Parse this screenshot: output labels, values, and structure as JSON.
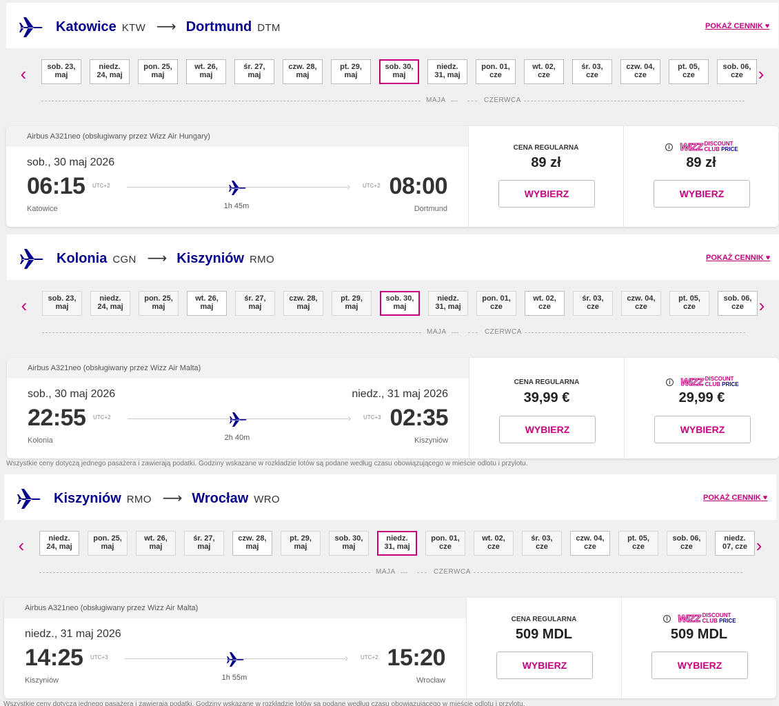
{
  "colors": {
    "brand_blue": "#06038d",
    "brand_pink": "#c6007e"
  },
  "icons": {
    "route": "airplane-icon",
    "prev": "chevron-left-icon",
    "next": "chevron-right-icon",
    "info": "info-icon"
  },
  "common": {
    "pokaz_cennik": "POKAŻ CENNIK",
    "cena_regularna": "CENA REGULARNA",
    "wybierz": "WYBIERZ",
    "discount_club": {
      "brand": "WIZZ",
      "line1": "DISCOUNT",
      "line2": "CLUB",
      "line3": "PRICE"
    },
    "month_left": "MAJA",
    "month_right": "CZERWCA",
    "disclaimer": "Wszystkie ceny dotyczą jednego pasażera i zawierają podatki. Godziny wskazane w rozkładzie lotów są podane według czasu obowiązującego w mieście odlotu i przylotu."
  },
  "flights": [
    {
      "from_city": "Katowice",
      "from_code": "KTW",
      "to_city": "Dortmund",
      "to_code": "DTM",
      "dates": [
        {
          "l1": "sob. 23,",
          "l2": "maj",
          "state": "normal"
        },
        {
          "l1": "niedz.",
          "l2": "24, maj",
          "state": "normal"
        },
        {
          "l1": "pon. 25,",
          "l2": "maj",
          "state": "normal"
        },
        {
          "l1": "wt. 26,",
          "l2": "maj",
          "state": "normal"
        },
        {
          "l1": "śr. 27,",
          "l2": "maj",
          "state": "normal"
        },
        {
          "l1": "czw. 28,",
          "l2": "maj",
          "state": "normal"
        },
        {
          "l1": "pt. 29,",
          "l2": "maj",
          "state": "normal"
        },
        {
          "l1": "sob. 30,",
          "l2": "maj",
          "state": "selected"
        },
        {
          "l1": "niedz.",
          "l2": "31, maj",
          "state": "normal"
        },
        {
          "l1": "pon. 01,",
          "l2": "cze",
          "state": "normal"
        },
        {
          "l1": "wt. 02,",
          "l2": "cze",
          "state": "normal"
        },
        {
          "l1": "śr. 03,",
          "l2": "cze",
          "state": "normal"
        },
        {
          "l1": "czw. 04,",
          "l2": "cze",
          "state": "normal"
        },
        {
          "l1": "pt. 05,",
          "l2": "cze",
          "state": "normal"
        },
        {
          "l1": "sob. 06,",
          "l2": "cze",
          "state": "normal"
        }
      ],
      "aircraft": "Airbus A321neo (obsługiwany przez Wizz Air Hungary)",
      "dep_date": "sob., 30 maj 2026",
      "arr_date": "",
      "dep_time": "06:15",
      "dep_utc": "UTC+2",
      "arr_time": "08:00",
      "arr_utc": "UTC+2",
      "duration": "1h 45m",
      "price_regular": "89 zł",
      "price_club": "89 zł"
    },
    {
      "from_city": "Kolonia",
      "from_code": "CGN",
      "to_city": "Kiszyniów",
      "to_code": "RMO",
      "dates": [
        {
          "l1": "sob. 23,",
          "l2": "maj",
          "state": "dim"
        },
        {
          "l1": "niedz.",
          "l2": "24, maj",
          "state": "dim"
        },
        {
          "l1": "pon. 25,",
          "l2": "maj",
          "state": "dim"
        },
        {
          "l1": "wt. 26,",
          "l2": "maj",
          "state": "normal"
        },
        {
          "l1": "śr. 27,",
          "l2": "maj",
          "state": "dim"
        },
        {
          "l1": "czw. 28,",
          "l2": "maj",
          "state": "dim"
        },
        {
          "l1": "pt. 29,",
          "l2": "maj",
          "state": "dim"
        },
        {
          "l1": "sob. 30,",
          "l2": "maj",
          "state": "selected"
        },
        {
          "l1": "niedz.",
          "l2": "31, maj",
          "state": "dim"
        },
        {
          "l1": "pon. 01,",
          "l2": "cze",
          "state": "dim"
        },
        {
          "l1": "wt. 02,",
          "l2": "cze",
          "state": "normal"
        },
        {
          "l1": "śr. 03,",
          "l2": "cze",
          "state": "dim"
        },
        {
          "l1": "czw. 04,",
          "l2": "cze",
          "state": "dim"
        },
        {
          "l1": "pt. 05,",
          "l2": "cze",
          "state": "dim"
        },
        {
          "l1": "sob. 06,",
          "l2": "cze",
          "state": "normal"
        }
      ],
      "aircraft": "Airbus A321neo (obsługiwany przez Wizz Air Malta)",
      "dep_date": "sob., 30 maj 2026",
      "arr_date": "niedz., 31 maj 2026",
      "dep_time": "22:55",
      "dep_utc": "UTC+2",
      "arr_time": "02:35",
      "arr_utc": "UTC+3",
      "duration": "2h 40m",
      "price_regular": "39,99 €",
      "price_club": "29,99 €"
    },
    {
      "from_city": "Kiszyniów",
      "from_code": "RMO",
      "to_city": "Wrocław",
      "to_code": "WRO",
      "dates": [
        {
          "l1": "niedz.",
          "l2": "24, maj",
          "state": "normal"
        },
        {
          "l1": "pon. 25,",
          "l2": "maj",
          "state": "dim"
        },
        {
          "l1": "wt. 26,",
          "l2": "maj",
          "state": "dim"
        },
        {
          "l1": "śr. 27,",
          "l2": "maj",
          "state": "dim"
        },
        {
          "l1": "czw. 28,",
          "l2": "maj",
          "state": "normal"
        },
        {
          "l1": "pt. 29,",
          "l2": "maj",
          "state": "dim"
        },
        {
          "l1": "sob. 30,",
          "l2": "maj",
          "state": "dim"
        },
        {
          "l1": "niedz.",
          "l2": "31, maj",
          "state": "selected"
        },
        {
          "l1": "pon. 01,",
          "l2": "cze",
          "state": "dim"
        },
        {
          "l1": "wt. 02,",
          "l2": "cze",
          "state": "dim"
        },
        {
          "l1": "śr. 03,",
          "l2": "cze",
          "state": "dim"
        },
        {
          "l1": "czw. 04,",
          "l2": "cze",
          "state": "normal"
        },
        {
          "l1": "pt. 05,",
          "l2": "cze",
          "state": "dim"
        },
        {
          "l1": "sob. 06,",
          "l2": "cze",
          "state": "dim"
        },
        {
          "l1": "niedz.",
          "l2": "07, cze",
          "state": "normal"
        }
      ],
      "aircraft": "Airbus A321neo (obsługiwany przez Wizz Air Malta)",
      "dep_date": "niedz., 31 maj 2026",
      "arr_date": "",
      "dep_time": "14:25",
      "dep_utc": "UTC+3",
      "arr_time": "15:20",
      "arr_utc": "UTC+2",
      "duration": "1h 55m",
      "price_regular": "509 MDL",
      "price_club": "509 MDL"
    }
  ]
}
